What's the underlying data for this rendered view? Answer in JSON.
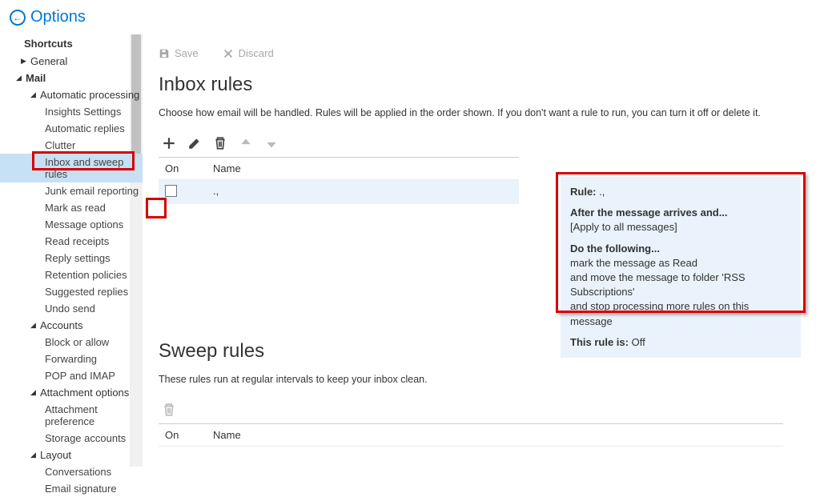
{
  "header": {
    "title": "Options"
  },
  "sidebar": {
    "heading": "Shortcuts",
    "general": "General",
    "mail": "Mail",
    "automatic_processing": "Automatic processing",
    "insights": "Insights Settings",
    "auto_replies": "Automatic replies",
    "clutter": "Clutter",
    "inbox_sweep": "Inbox and sweep rules",
    "junk": "Junk email reporting",
    "mark_read": "Mark as read",
    "msg_options": "Message options",
    "read_receipts": "Read receipts",
    "reply_settings": "Reply settings",
    "retention": "Retention policies",
    "suggested": "Suggested replies",
    "undo": "Undo send",
    "accounts": "Accounts",
    "block_allow": "Block or allow",
    "forwarding": "Forwarding",
    "pop_imap": "POP and IMAP",
    "attachment_opts": "Attachment options",
    "attachment_pref": "Attachment preference",
    "storage": "Storage accounts",
    "layout": "Layout",
    "conversations": "Conversations",
    "email_sig": "Email signature"
  },
  "toolbar": {
    "save": "Save",
    "discard": "Discard"
  },
  "inbox": {
    "title": "Inbox rules",
    "desc": "Choose how email will be handled. Rules will be applied in the order shown. If you don't want a rule to run, you can turn it off or delete it.",
    "col_on": "On",
    "col_name": "Name",
    "row_name": ".,"
  },
  "detail": {
    "rule_label": "Rule:",
    "rule_name": ".,",
    "after_label": "After the message arrives and...",
    "apply_all": "[Apply to all messages]",
    "do_label": "Do the following...",
    "line1": "mark the message as Read",
    "line2": "and move the message to folder 'RSS Subscriptions'",
    "line3": "and stop processing more rules on this message",
    "status_label": "This rule is:",
    "status_value": "Off"
  },
  "sweep": {
    "title": "Sweep rules",
    "desc": "These rules run at regular intervals to keep your inbox clean.",
    "col_on": "On",
    "col_name": "Name"
  }
}
